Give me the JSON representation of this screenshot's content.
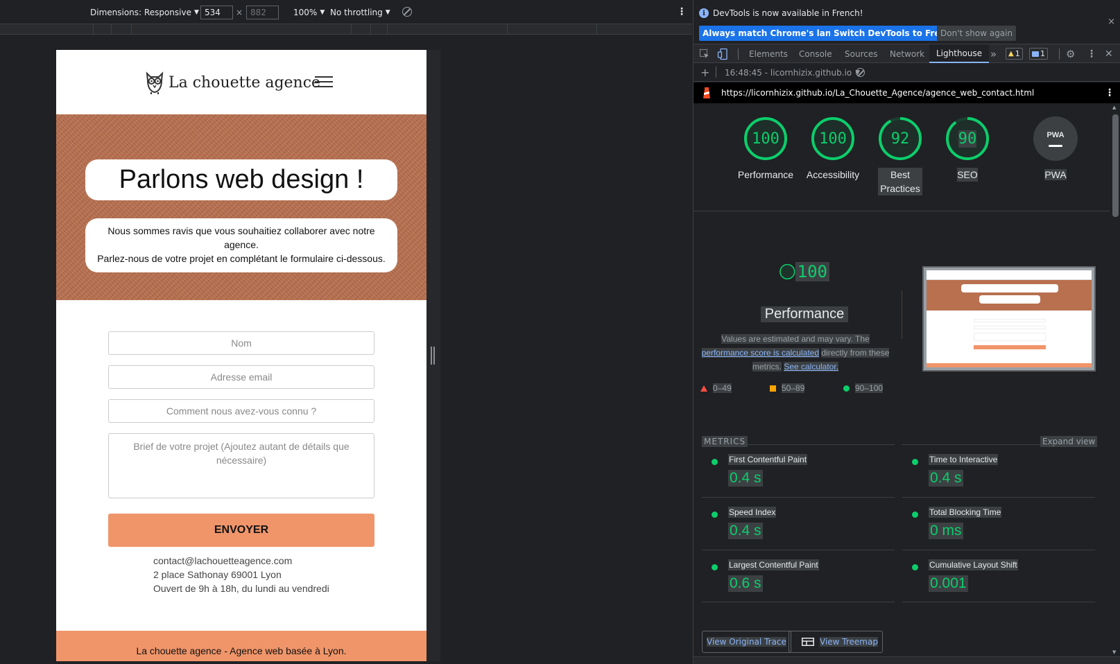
{
  "device_toolbar": {
    "dimensions_label": "Dimensions: Responsive",
    "width_value": "534",
    "times": "×",
    "height_value": "882",
    "zoom": "100%",
    "throttling": "No throttling"
  },
  "site": {
    "logo_text": "La chouette agence",
    "hero_title": "Parlons web design !",
    "hero_text_1": "Nous sommes ravis que vous souhaitiez collaborer avec notre agence.",
    "hero_text_2": "Parlez-nous de votre projet en complétant le formulaire ci-dessous.",
    "form": {
      "name_placeholder": "Nom",
      "email_placeholder": "Adresse email",
      "source_placeholder": "Comment nous avez-vous connu ?",
      "brief_placeholder": "Brief de votre projet (Ajoutez autant de détails que nécessaire)",
      "submit_label": "ENVOYER"
    },
    "contact": {
      "email": "contact@lachouetteagence.com",
      "address": "2 place Sathonay 69001 Lyon",
      "hours": "Ouvert de 9h à 18h, du lundi au vendredi"
    },
    "footer_text": "La chouette agence - Agence web basée à Lyon."
  },
  "devtools": {
    "infobar": {
      "message": "DevTools is now available in French!",
      "btn_match": "Always match Chrome's language",
      "btn_switch": "Switch DevTools to French",
      "btn_dismiss": "Don't show again",
      "close": "×"
    },
    "tabs": [
      "Elements",
      "Console",
      "Sources",
      "Network",
      "Lighthouse"
    ],
    "more_tabs": "»",
    "warnings_count": "1",
    "messages_count": "1",
    "report_selector": "16:48:45 - licornhizix.github.io",
    "url": "https://licornhizix.github.io/La_Chouette_Agence/agence_web_contact.html",
    "scores": [
      {
        "label": "Performance",
        "value": "100",
        "score": 100
      },
      {
        "label": "Accessibility",
        "value": "100",
        "score": 100
      },
      {
        "label": "Best Practices",
        "value": "92",
        "score": 92
      },
      {
        "label": "SEO",
        "value": "90",
        "score": 90
      }
    ],
    "pwa_label": "PWA",
    "pwa_badge": "PWA",
    "perf_big_value": "100",
    "perf_big_title": "Performance",
    "perf_note_1": "Values are estimated and may vary. The",
    "perf_note_link": "performance score is calculated",
    "perf_note_2": "directly from these metrics.",
    "perf_note_calc": "See calculator.",
    "legend": [
      "0–49",
      "50–89",
      "90–100"
    ],
    "metrics_title": "METRICS",
    "expand_view": "Expand view",
    "metrics": [
      {
        "name": "First Contentful Paint",
        "value": "0.4 s"
      },
      {
        "name": "Time to Interactive",
        "value": "0.4 s"
      },
      {
        "name": "Speed Index",
        "value": "0.4 s"
      },
      {
        "name": "Total Blocking Time",
        "value": "0 ms"
      },
      {
        "name": "Largest Contentful Paint",
        "value": "0.6 s"
      },
      {
        "name": "Cumulative Layout Shift",
        "value": "0.001"
      }
    ],
    "view_trace": "View Original Trace",
    "view_treemap": "View Treemap"
  },
  "colors": {
    "pass_green": "#0cce6b",
    "hero_brown": "#b8704f",
    "button_orange": "#f0956a",
    "devtools_blue": "#1a73e8"
  }
}
